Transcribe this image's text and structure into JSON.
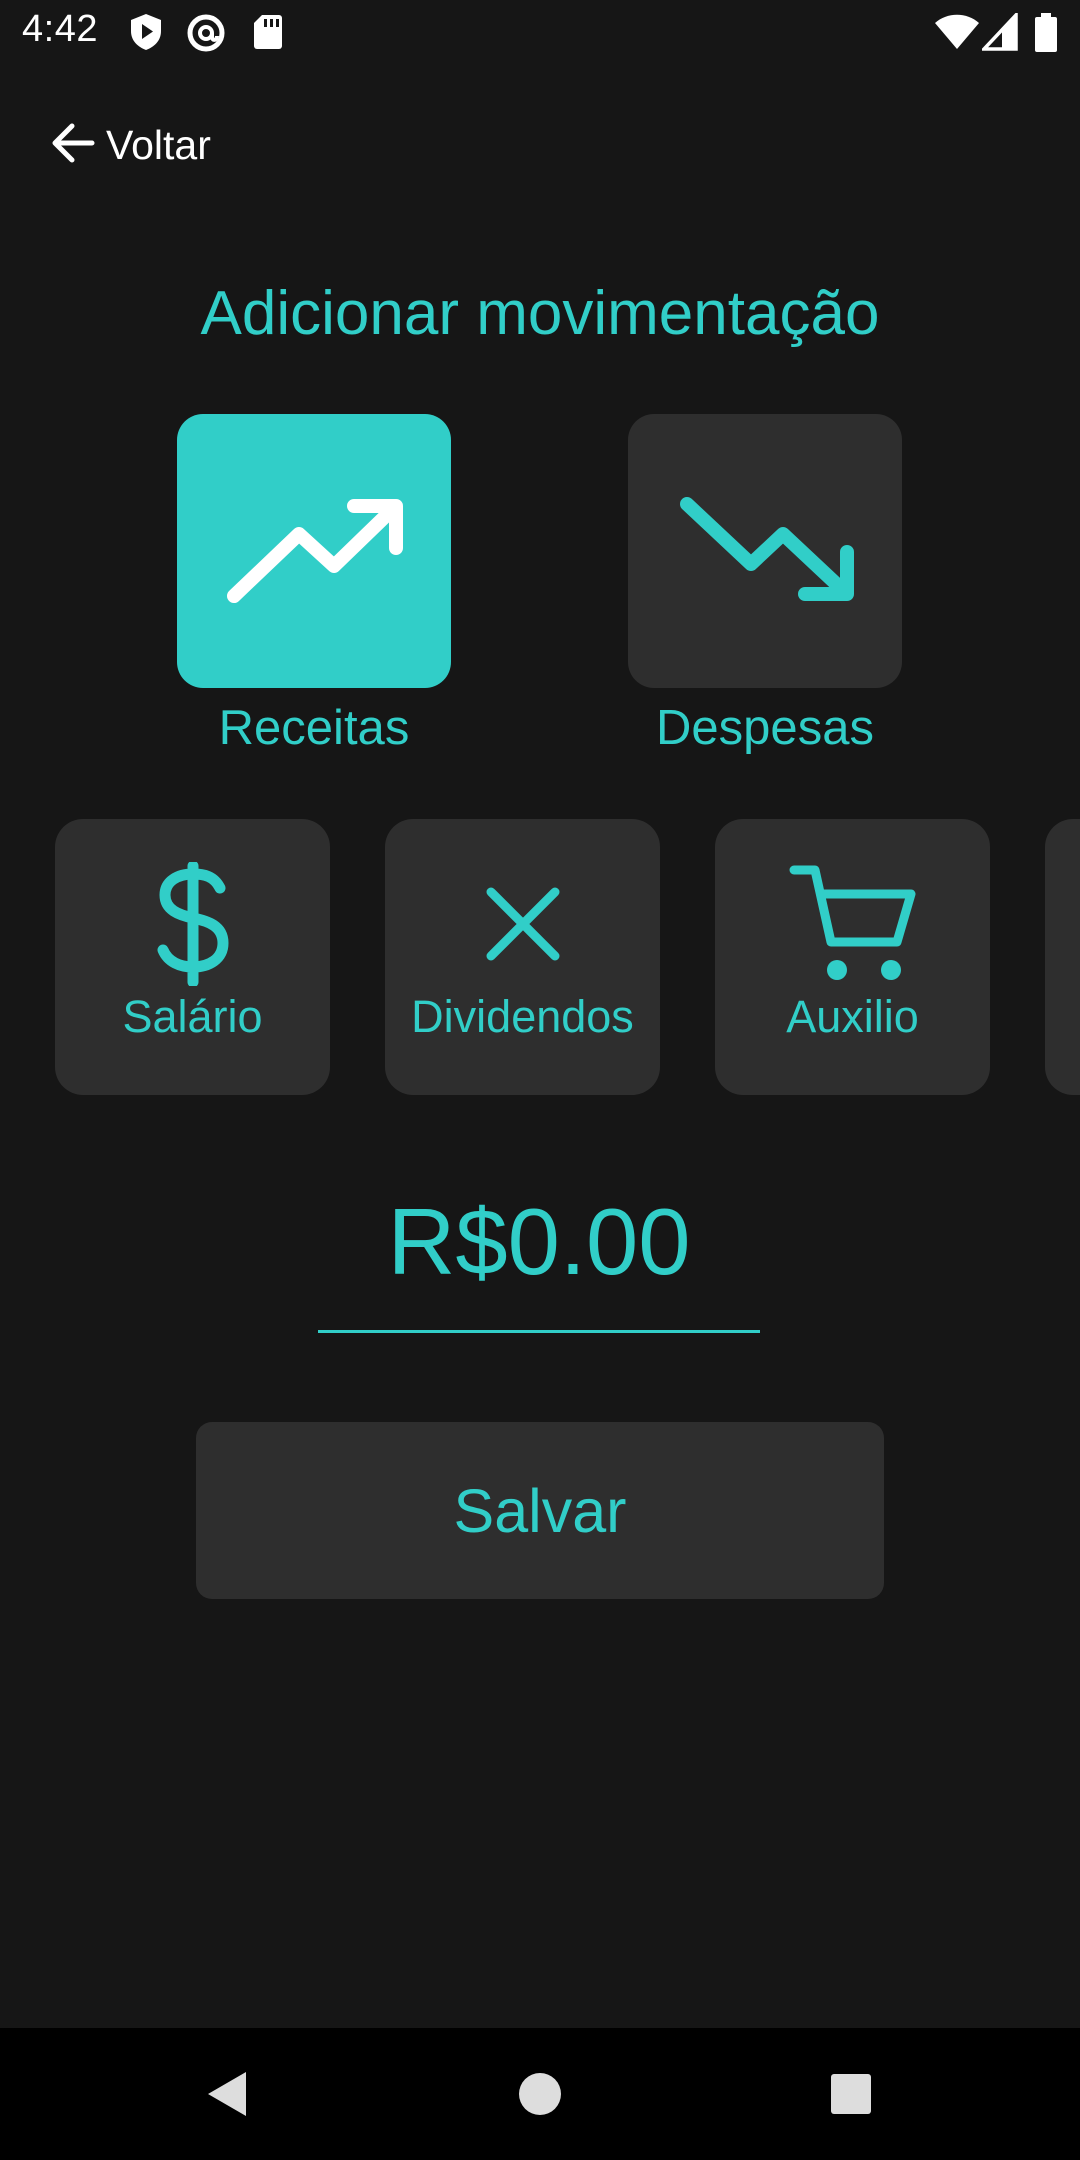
{
  "status_bar": {
    "time": "4:42",
    "left_icons": [
      "shield-play-icon",
      "at-sign-icon",
      "sd-card-icon"
    ],
    "right_icons": [
      "wifi-icon",
      "cell-signal-icon",
      "battery-icon"
    ]
  },
  "header": {
    "back_label": "Voltar",
    "back_icon": "arrow-left-icon"
  },
  "page_title": "Adicionar movimentação",
  "types": [
    {
      "label": "Receitas",
      "icon": "trending-up-icon",
      "selected": true
    },
    {
      "label": "Despesas",
      "icon": "trending-down-icon",
      "selected": false
    }
  ],
  "categories": [
    {
      "label": "Salário",
      "icon": "dollar-icon"
    },
    {
      "label": "Dividendos",
      "icon": "close-x-icon"
    },
    {
      "label": "Auxilio",
      "icon": "shopping-cart-icon"
    },
    {
      "label": "",
      "icon": ""
    }
  ],
  "amount": {
    "value": "R$0.00"
  },
  "save_label": "Salvar",
  "nav": [
    "back-triangle-icon",
    "home-circle-icon",
    "recents-square-icon"
  ],
  "colors": {
    "background": "#161616",
    "accent": "#31cec8",
    "card": "#2e2e2e",
    "selected_card": "#31cec8",
    "nav_bar": "#000000"
  }
}
